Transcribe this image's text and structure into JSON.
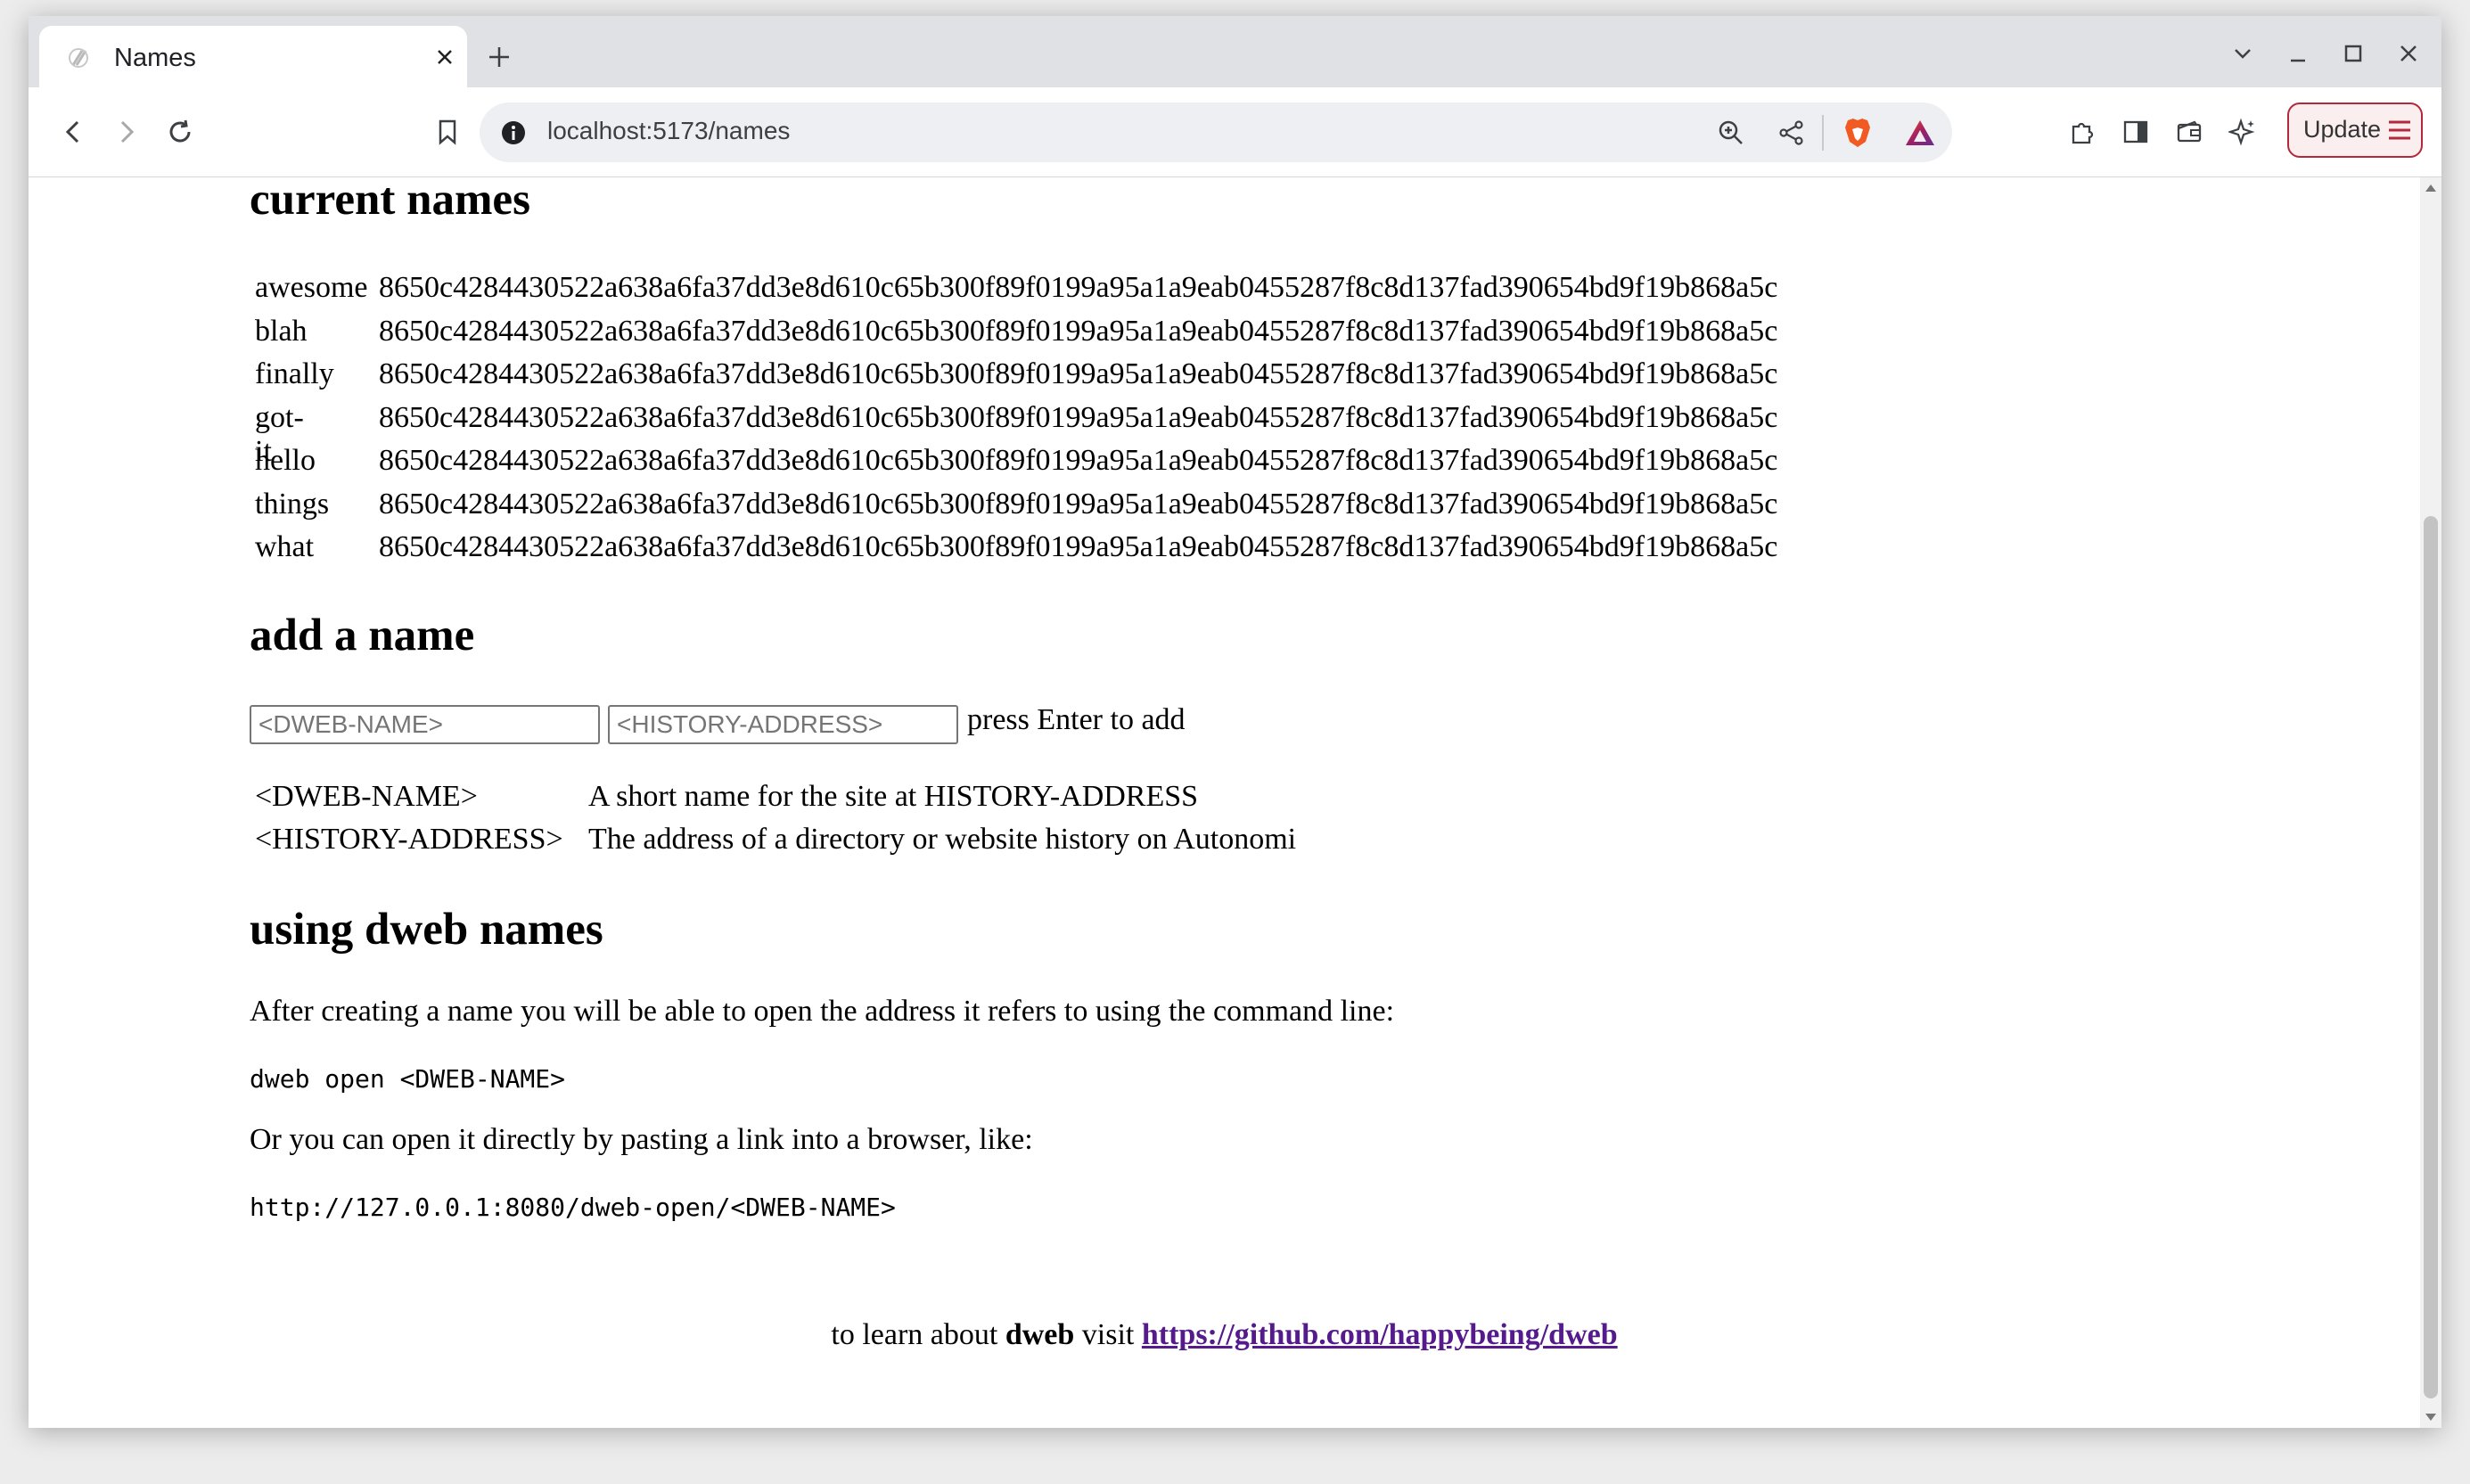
{
  "browser": {
    "tab_title": "Names",
    "url": "localhost:5173/names",
    "update_label": "Update"
  },
  "colors": {
    "link": "#551a8b",
    "update_accent": "#b3283a"
  },
  "icons": [
    "tab-favicon-icon",
    "close-icon",
    "plus-icon",
    "chevron-down-icon",
    "minimize-icon",
    "maximize-icon",
    "close-window-icon",
    "back-icon",
    "forward-icon",
    "reload-icon",
    "bookmark-icon",
    "info-icon",
    "zoom-icon",
    "share-icon",
    "brave-shield-icon",
    "brave-rewards-icon",
    "extensions-icon",
    "sidebar-icon",
    "wallet-icon",
    "leo-ai-icon",
    "hamburger-menu-icon"
  ],
  "page": {
    "current_names": {
      "heading": "current names",
      "rows": [
        {
          "name": "awesome",
          "hash": "8650c4284430522a638a6fa37dd3e8d610c65b300f89f0199a95a1a9eab0455287f8c8d137fad390654bd9f19b868a5c"
        },
        {
          "name": "blah",
          "hash": "8650c4284430522a638a6fa37dd3e8d610c65b300f89f0199a95a1a9eab0455287f8c8d137fad390654bd9f19b868a5c"
        },
        {
          "name": "finally",
          "hash": "8650c4284430522a638a6fa37dd3e8d610c65b300f89f0199a95a1a9eab0455287f8c8d137fad390654bd9f19b868a5c"
        },
        {
          "name": "got-it",
          "hash": "8650c4284430522a638a6fa37dd3e8d610c65b300f89f0199a95a1a9eab0455287f8c8d137fad390654bd9f19b868a5c"
        },
        {
          "name": "hello",
          "hash": "8650c4284430522a638a6fa37dd3e8d610c65b300f89f0199a95a1a9eab0455287f8c8d137fad390654bd9f19b868a5c"
        },
        {
          "name": "things",
          "hash": "8650c4284430522a638a6fa37dd3e8d610c65b300f89f0199a95a1a9eab0455287f8c8d137fad390654bd9f19b868a5c"
        },
        {
          "name": "what",
          "hash": "8650c4284430522a638a6fa37dd3e8d610c65b300f89f0199a95a1a9eab0455287f8c8d137fad390654bd9f19b868a5c"
        }
      ]
    },
    "add_name": {
      "heading": "add a name",
      "name_placeholder": "<DWEB-NAME>",
      "address_placeholder": "<HISTORY-ADDRESS>",
      "hint": "press Enter to add",
      "legend": [
        {
          "term": "<DWEB-NAME>",
          "desc": "A short name for the site at HISTORY-ADDRESS"
        },
        {
          "term": "<HISTORY-ADDRESS>",
          "desc": "The address of a directory or website history on Autonomi"
        }
      ]
    },
    "using": {
      "heading": "using dweb names",
      "p1": "After creating a name you will be able to open the address it refers to using the command line:",
      "code1": "dweb open <DWEB-NAME>",
      "p2": "Or you can open it directly by pasting a link into a browser, like:",
      "code2": "http://127.0.0.1:8080/dweb-open/<DWEB-NAME>"
    },
    "footer": {
      "prefix": "to learn about",
      "bold": "dweb",
      "mid": "visit",
      "link": "https://github.com/happybeing/dweb"
    }
  }
}
